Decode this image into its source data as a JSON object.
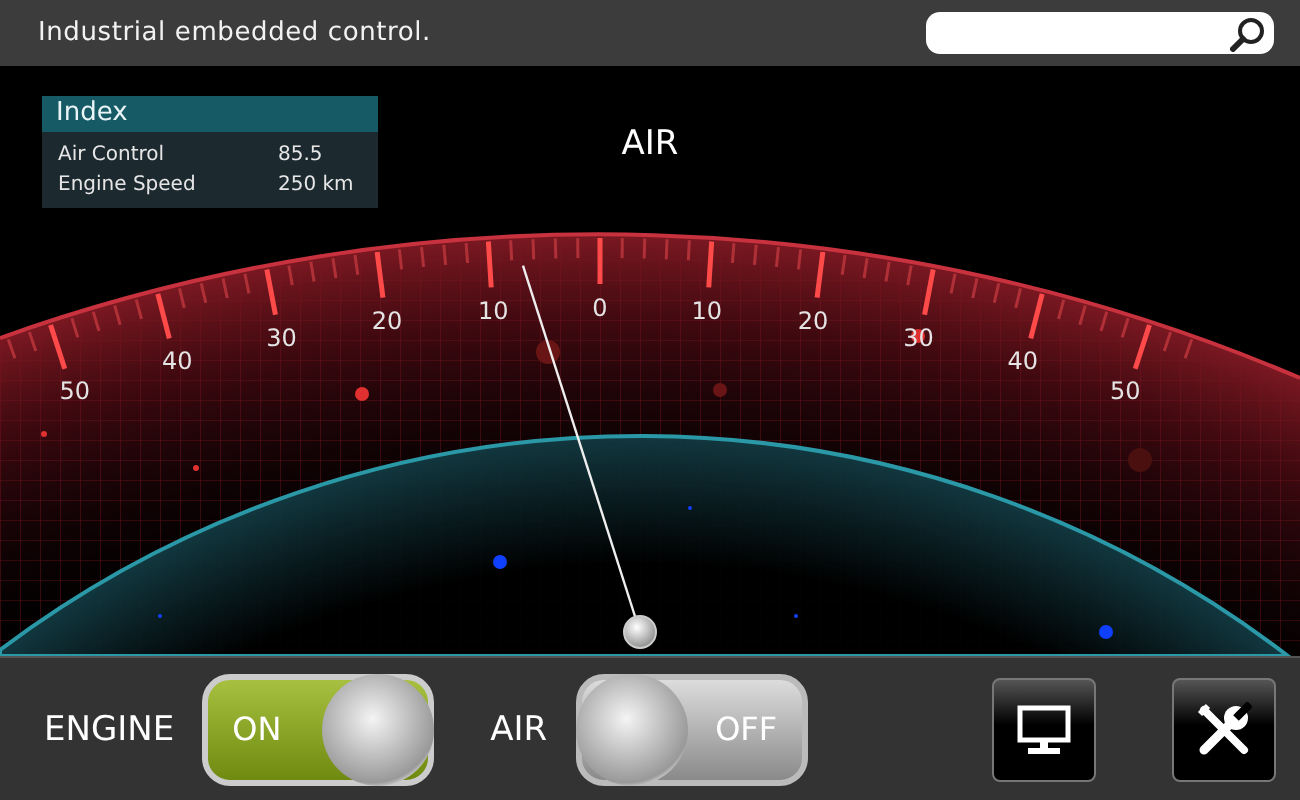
{
  "header": {
    "title": "Industrial embedded control."
  },
  "index_panel": {
    "title": "Index",
    "rows": [
      {
        "label": "Air Control",
        "value": "85.5"
      },
      {
        "label": "Engine Speed",
        "value": "250 km"
      }
    ]
  },
  "gauge": {
    "title": "AIR",
    "scale_labels": [
      "50",
      "40",
      "30",
      "20",
      "10",
      "0",
      "10",
      "20",
      "30",
      "40",
      "50"
    ],
    "level": 0.43
  },
  "controls": {
    "toggles": [
      {
        "label": "ENGINE",
        "state_text": "ON",
        "on": true
      },
      {
        "label": "AIR",
        "state_text": "OFF",
        "on": false
      }
    ],
    "buttons": [
      {
        "kind": "monitor"
      },
      {
        "kind": "tools"
      }
    ]
  }
}
